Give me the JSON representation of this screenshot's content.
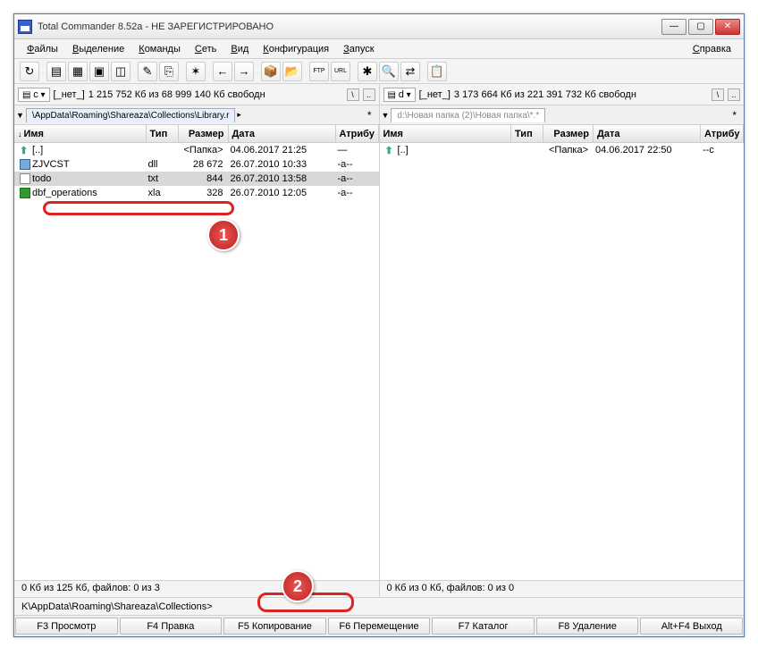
{
  "window": {
    "title": "Total Commander 8.52a - НЕ ЗАРЕГИСТРИРОВАНО"
  },
  "menu": {
    "files": "Файлы",
    "selection": "Выделение",
    "commands": "Команды",
    "net": "Сеть",
    "view": "Вид",
    "config": "Конфигурация",
    "start": "Запуск",
    "help": "Справка"
  },
  "toolbar_icons": {
    "refresh": "↻",
    "view1": "▤",
    "view2": "▦",
    "tree": "▣",
    "show": "◫",
    "edit": "✎",
    "copy": "⎘",
    "star": "✶",
    "back": "←",
    "fwd": "→",
    "zip": "📦",
    "unzip": "📂",
    "ftp": "FTP",
    "url": "URL",
    "multi": "✱",
    "find": "🔍",
    "sync": "⇄",
    "notes": "📋"
  },
  "left": {
    "drive": "c",
    "drive_label": "[_нет_]",
    "space": "1 215 752 Кб из 68 999 140 Кб свободн",
    "tab": "\\AppData\\Roaming\\Shareaza\\Collections\\Library.r",
    "cols": {
      "name": "Имя",
      "ext": "Тип",
      "size": "Размер",
      "date": "Дата",
      "attr": "Атрибу"
    },
    "rows": [
      {
        "icon": "up",
        "name": "[..]",
        "ext": "",
        "size": "<Папка>",
        "date": "04.06.2017 21:25",
        "attr": "—",
        "selected": false
      },
      {
        "icon": "dll",
        "name": "ZJVCST",
        "ext": "dll",
        "size": "28 672",
        "date": "26.07.2010 10:33",
        "attr": "-a--",
        "selected": false
      },
      {
        "icon": "txt",
        "name": "todo",
        "ext": "txt",
        "size": "844",
        "date": "26.07.2010 13:58",
        "attr": "-a--",
        "selected": true
      },
      {
        "icon": "xla",
        "name": "dbf_operations",
        "ext": "xla",
        "size": "328",
        "date": "26.07.2010 12:05",
        "attr": "-a--",
        "selected": false
      }
    ],
    "status": "0 Кб из 125 Кб, файлов: 0 из 3"
  },
  "right": {
    "drive": "d",
    "drive_label": "[_нет_]",
    "space": "3 173 664 Кб из 221 391 732 Кб свободн",
    "tab": "d:\\Новая папка (2)\\Новая папка\\*.*",
    "cols": {
      "name": "Имя",
      "ext": "Тип",
      "size": "Размер",
      "date": "Дата",
      "attr": "Атрибу"
    },
    "rows": [
      {
        "icon": "up",
        "name": "[..]",
        "ext": "",
        "size": "<Папка>",
        "date": "04.06.2017 22:50",
        "attr": "--с",
        "selected": false
      }
    ],
    "status": "0 Кб из 0 Кб, файлов: 0 из 0"
  },
  "cmdline": "K\\AppData\\Roaming\\Shareaza\\Collections>",
  "fn": {
    "f3": "F3 Просмотр",
    "f4": "F4 Правка",
    "f5": "F5 Копирование",
    "f6": "F6 Перемещение",
    "f7": "F7 Каталог",
    "f8": "F8 Удаление",
    "altf4": "Alt+F4 Выход"
  },
  "badges": {
    "b1": "1",
    "b2": "2"
  }
}
